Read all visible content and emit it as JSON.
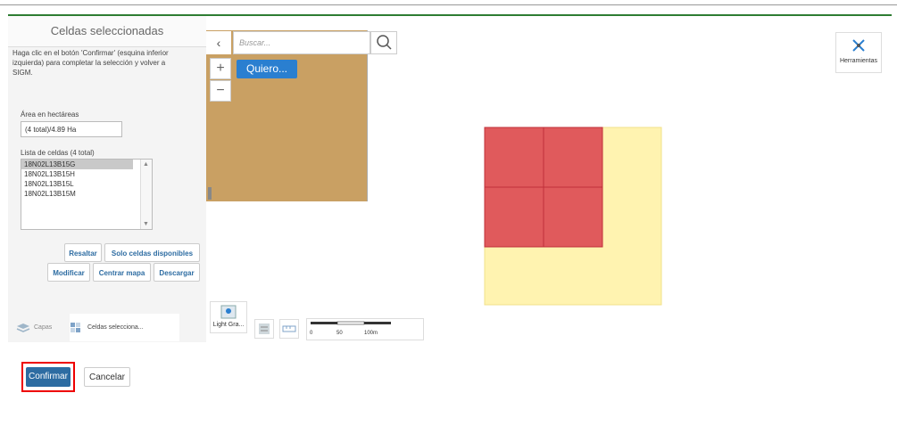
{
  "sidebar": {
    "title": "Celdas seleccionadas",
    "instructions": "Haga clic en el botón 'Confirmar' (esquina inferior izquierda) para completar la selección y volver a SIGM.",
    "area_label": "Área en hectáreas",
    "area_value": "(4 total)/4.89 Ha",
    "list_label": "Lista de celdas (4 total)",
    "cells": [
      "18N02L13B15G",
      "18N02L13B15H",
      "18N02L13B15L",
      "18N02L13B15M"
    ],
    "buttons": {
      "resaltar": "Resaltar",
      "solo_disponibles": "Solo celdas disponibles",
      "modificar": "Modificar",
      "centrar": "Centrar mapa",
      "descargar": "Descargar"
    },
    "tabs": [
      {
        "label": "Capas",
        "icon": "layers-icon"
      },
      {
        "label": "Celdas selecciona...",
        "icon": "grid-cells-icon"
      }
    ]
  },
  "map": {
    "search_placeholder": "Buscar...",
    "quiero_label": "Quiero...",
    "tools_label": "Herramientas",
    "basemap_label": "Light Gra...",
    "scale_labels": [
      "0",
      "50",
      "100m"
    ],
    "colors": {
      "selected_cell": "#e05a5c",
      "available_area": "#fff3b0",
      "nav_panel": "#c9a063"
    }
  },
  "footer": {
    "confirm_label": "Confirmar",
    "cancel_label": "Cancelar"
  }
}
